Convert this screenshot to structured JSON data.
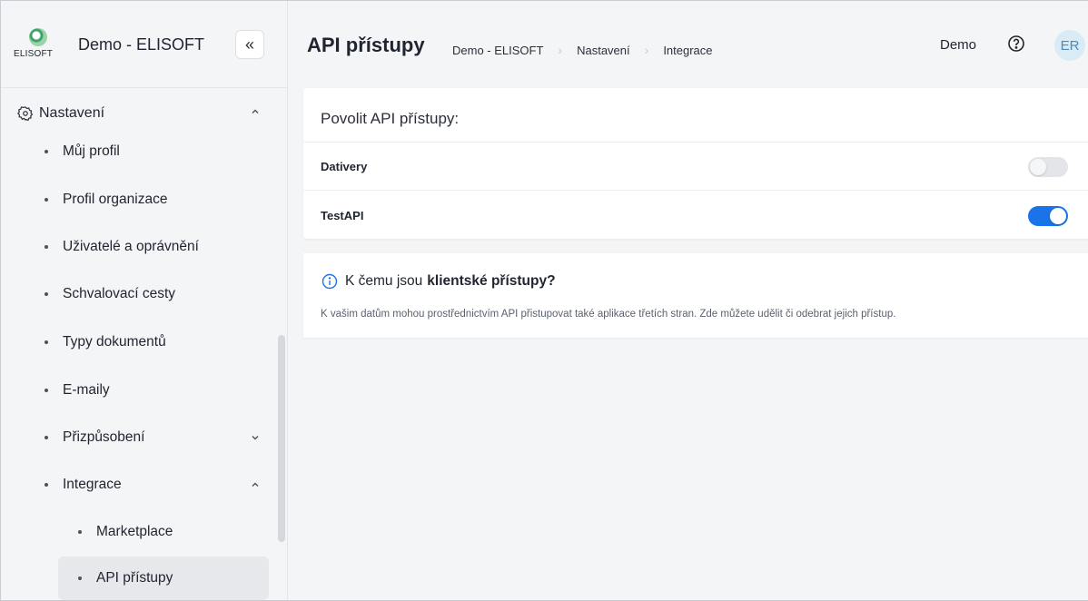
{
  "brand": {
    "logo_text": "ELISOFT",
    "org_name": "Demo - ELISOFT",
    "collapse_icon": "«"
  },
  "sidebar": {
    "group_label": "Nastavení",
    "items": [
      {
        "label": "Můj profil"
      },
      {
        "label": "Profil organizace"
      },
      {
        "label": "Uživatelé a oprávnění"
      },
      {
        "label": "Schvalovací cesty"
      },
      {
        "label": "Typy dokumentů"
      },
      {
        "label": "E-maily"
      },
      {
        "label": "Přizpůsobení",
        "expandable": true,
        "expanded": false
      },
      {
        "label": "Integrace",
        "expandable": true,
        "expanded": true
      }
    ],
    "sub_items": [
      {
        "label": "Marketplace"
      },
      {
        "label": "API přístupy",
        "active": true
      }
    ]
  },
  "header": {
    "title": "API přístupy",
    "breadcrumb": [
      "Demo - ELISOFT",
      "Nastavení",
      "Integrace"
    ],
    "user_label": "Demo",
    "avatar_initials": "ER"
  },
  "api_access": {
    "heading": "Povolit API přístupy:",
    "rows": [
      {
        "name": "Dativery",
        "enabled": false
      },
      {
        "name": "TestAPI",
        "enabled": true
      }
    ]
  },
  "info": {
    "title_prefix": "K čemu jsou",
    "title_bold": "klientské přístupy?",
    "text": "K vašim datům mohou prostřednictvím API přistupovat také aplikace třetích stran. Zde můžete udělit či odebrat jejich přístup."
  },
  "colors": {
    "accent": "#1a73e8",
    "avatar_bg": "#d9ecf5",
    "logo_green": "#3ea36b"
  }
}
